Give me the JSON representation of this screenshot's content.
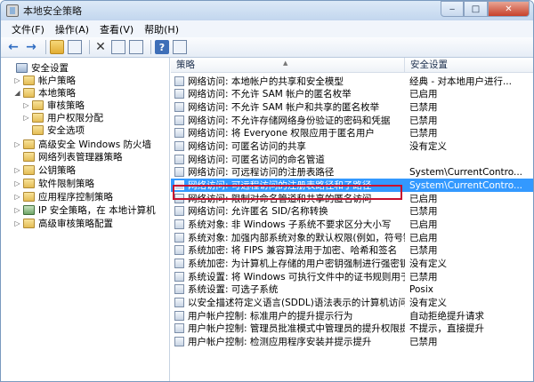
{
  "window": {
    "title": "本地安全策略",
    "min_label": "‒",
    "max_label": "□",
    "close_label": "✕"
  },
  "menu": [
    "文件(F)",
    "操作(A)",
    "查看(V)",
    "帮助(H)"
  ],
  "tree": [
    {
      "label": "安全设置",
      "toggle": "",
      "icon": "pc"
    },
    {
      "label": "帐户策略",
      "toggle": "▷",
      "icon": "folder"
    },
    {
      "label": "本地策略",
      "toggle": "◢",
      "icon": "folder"
    },
    {
      "label": "审核策略",
      "toggle": "▷",
      "icon": "folder"
    },
    {
      "label": "用户权限分配",
      "toggle": "▷",
      "icon": "folder"
    },
    {
      "label": "安全选项",
      "toggle": "",
      "icon": "folder"
    },
    {
      "label": "高级安全 Windows 防火墙",
      "toggle": "▷",
      "icon": "folder"
    },
    {
      "label": "网络列表管理器策略",
      "toggle": "",
      "icon": "folder"
    },
    {
      "label": "公钥策略",
      "toggle": "▷",
      "icon": "folder"
    },
    {
      "label": "软件限制策略",
      "toggle": "▷",
      "icon": "folder"
    },
    {
      "label": "应用程序控制策略",
      "toggle": "▷",
      "icon": "folder"
    },
    {
      "label": "IP 安全策略，在 本地计算机",
      "toggle": "▷",
      "icon": "net"
    },
    {
      "label": "高级审核策略配置",
      "toggle": "▷",
      "icon": "folder"
    }
  ],
  "list": {
    "col_policy": "策略",
    "col_setting": "安全设置",
    "rows": [
      {
        "policy": "网络访问: 本地帐户的共享和安全模型",
        "setting": "经典 - 对本地用户进行..."
      },
      {
        "policy": "网络访问: 不允许 SAM 帐户的匿名枚举",
        "setting": "已启用"
      },
      {
        "policy": "网络访问: 不允许 SAM 帐户和共享的匿名枚举",
        "setting": "已禁用"
      },
      {
        "policy": "网络访问: 不允许存储网络身份验证的密码和凭据",
        "setting": "已禁用"
      },
      {
        "policy": "网络访问: 将 Everyone 权限应用于匿名用户",
        "setting": "已禁用"
      },
      {
        "policy": "网络访问: 可匿名访问的共享",
        "setting": "没有定义"
      },
      {
        "policy": "网络访问: 可匿名访问的命名管道",
        "setting": ""
      },
      {
        "policy": "网络访问: 可远程访问的注册表路径",
        "setting": "System\\CurrentContro..."
      },
      {
        "policy": "网络访问: 可远程访问的注册表路径和子路径",
        "setting": "System\\CurrentContro...",
        "selected": true
      },
      {
        "policy": "网络访问: 限制对命名管道和共享的匿名访问",
        "setting": "已启用"
      },
      {
        "policy": "网络访问: 允许匿名 SID/名称转换",
        "setting": "已禁用"
      },
      {
        "policy": "系统对象: 非 Windows 子系统不要求区分大小写",
        "setting": "已启用"
      },
      {
        "policy": "系统对象: 加强内部系统对象的默认权限(例如，符号链接)",
        "setting": "已启用"
      },
      {
        "policy": "系统加密: 将 FIPS 兼容算法用于加密、哈希和签名",
        "setting": "已禁用"
      },
      {
        "policy": "系统加密: 为计算机上存储的用户密钥强制进行强密钥保护",
        "setting": "没有定义"
      },
      {
        "policy": "系统设置: 将 Windows 可执行文件中的证书规则用于软件...",
        "setting": "已禁用"
      },
      {
        "policy": "系统设置: 可选子系统",
        "setting": "Posix"
      },
      {
        "policy": "以安全描述符定义语言(SDDL)语法表示的计算机访问限制",
        "setting": "没有定义"
      },
      {
        "policy": "用户帐户控制: 标准用户的提升提示行为",
        "setting": "自动拒绝提升请求"
      },
      {
        "policy": "用户帐户控制: 管理员批准模式中管理员的提升权限提示的...",
        "setting": "不提示，直接提升"
      },
      {
        "policy": "用户帐户控制: 检测应用程序安装并提示提升",
        "setting": "已禁用"
      }
    ]
  }
}
